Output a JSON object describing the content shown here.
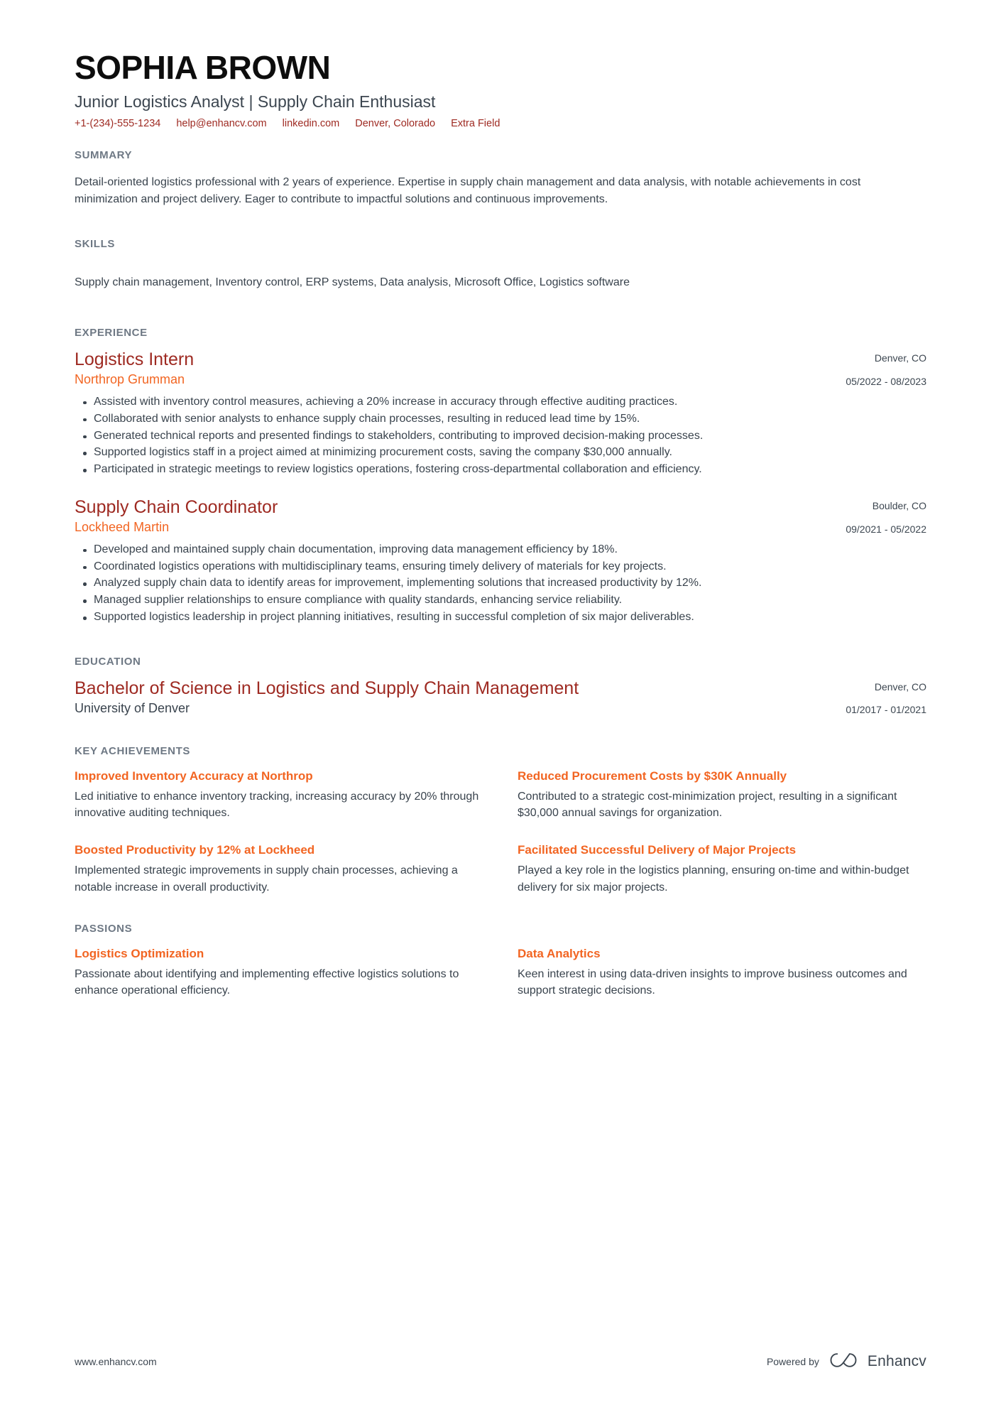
{
  "header": {
    "name": "SOPHIA BROWN",
    "headline": "Junior Logistics Analyst | Supply Chain Enthusiast",
    "contacts": [
      {
        "name": "phone",
        "text": "+1-(234)-555-1234"
      },
      {
        "name": "email",
        "text": "help@enhancv.com"
      },
      {
        "name": "linkedin",
        "text": "linkedin.com"
      },
      {
        "name": "location",
        "text": "Denver, Colorado"
      },
      {
        "name": "extra",
        "text": "Extra Field"
      }
    ]
  },
  "summary": {
    "title": "SUMMARY",
    "text": "Detail-oriented logistics professional with 2 years of experience. Expertise in supply chain management and data analysis, with notable achievements in cost minimization and project delivery. Eager to contribute to impactful solutions and continuous improvements."
  },
  "skills": {
    "title": "SKILLS",
    "text": "Supply chain management, Inventory control, ERP systems, Data analysis, Microsoft Office, Logistics software"
  },
  "experience": {
    "title": "EXPERIENCE",
    "entries": [
      {
        "role": "Logistics Intern",
        "company": "Northrop Grumman",
        "location": "Denver, CO",
        "dates": "05/2022 - 08/2023",
        "bullets": [
          "Assisted with inventory control measures, achieving a 20% increase in accuracy through effective auditing practices.",
          "Collaborated with senior analysts to enhance supply chain processes, resulting in reduced lead time by 15%.",
          "Generated technical reports and presented findings to stakeholders, contributing to improved decision-making processes.",
          "Supported logistics staff in a project aimed at minimizing procurement costs, saving the company $30,000 annually.",
          "Participated in strategic meetings to review logistics operations, fostering cross-departmental collaboration and efficiency."
        ]
      },
      {
        "role": "Supply Chain Coordinator",
        "company": "Lockheed Martin",
        "location": "Boulder, CO",
        "dates": "09/2021 - 05/2022",
        "bullets": [
          "Developed and maintained supply chain documentation, improving data management efficiency by 18%.",
          "Coordinated logistics operations with multidisciplinary teams, ensuring timely delivery of materials for key projects.",
          "Analyzed supply chain data to identify areas for improvement, implementing solutions that increased productivity by 12%.",
          "Managed supplier relationships to ensure compliance with quality standards, enhancing service reliability.",
          "Supported logistics leadership in project planning initiatives, resulting in successful completion of six major deliverables."
        ]
      }
    ]
  },
  "education": {
    "title": "EDUCATION",
    "entries": [
      {
        "degree": "Bachelor of Science in Logistics and Supply Chain Management",
        "school": "University of Denver",
        "location": "Denver, CO",
        "dates": "01/2017 - 01/2021"
      }
    ]
  },
  "key_achievements": {
    "title": "KEY ACHIEVEMENTS",
    "items": [
      {
        "title": "Improved Inventory Accuracy at Northrop",
        "text": "Led initiative to enhance inventory tracking, increasing accuracy by 20% through innovative auditing techniques."
      },
      {
        "title": "Reduced Procurement Costs by $30K Annually",
        "text": "Contributed to a strategic cost-minimization project, resulting in a significant $30,000 annual savings for organization."
      },
      {
        "title": "Boosted Productivity by 12% at Lockheed",
        "text": "Implemented strategic improvements in supply chain processes, achieving a notable increase in overall productivity."
      },
      {
        "title": "Facilitated Successful Delivery of Major Projects",
        "text": "Played a key role in the logistics planning, ensuring on-time and within-budget delivery for six major projects."
      }
    ]
  },
  "passions": {
    "title": "PASSIONS",
    "items": [
      {
        "title": "Logistics Optimization",
        "text": "Passionate about identifying and implementing effective logistics solutions to enhance operational efficiency."
      },
      {
        "title": "Data Analytics",
        "text": "Keen interest in using data-driven insights to improve business outcomes and support strategic decisions."
      }
    ]
  },
  "footer": {
    "website": "www.enhancv.com",
    "powered_by": "Powered by",
    "brand": "Enhancv"
  },
  "colors": {
    "accent_red": "#9e2a22",
    "accent_orange": "#f26522",
    "section_heading": "#6e7884",
    "body": "#39434d"
  }
}
